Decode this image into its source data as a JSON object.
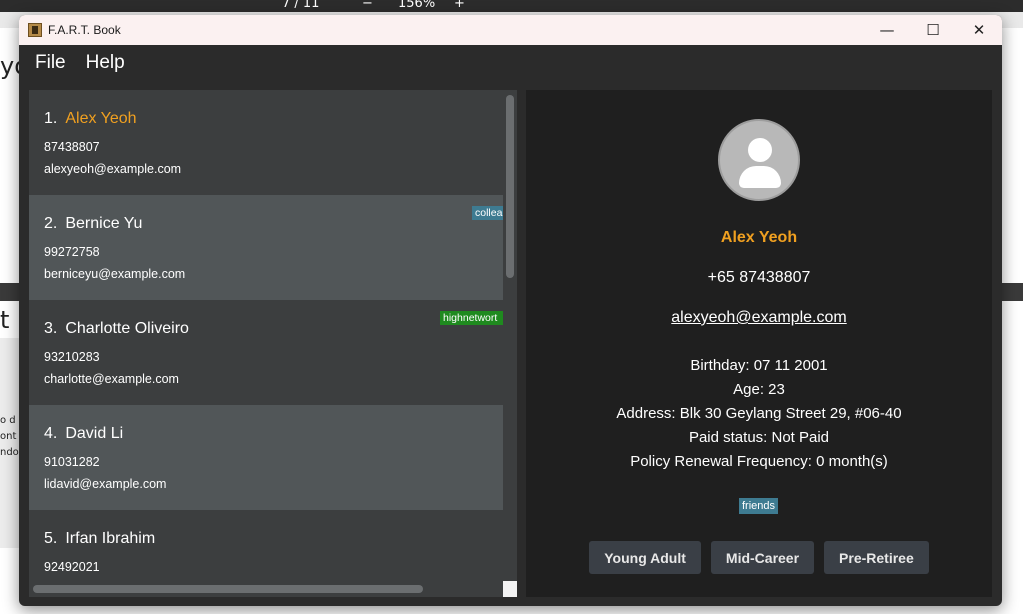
{
  "window": {
    "title": "F.A.R.T. Book",
    "minimize_glyph": "—",
    "maximize_glyph": "☐",
    "close_glyph": "✕"
  },
  "menu": {
    "items": [
      "File",
      "Help"
    ]
  },
  "persons": [
    {
      "index": "1.",
      "name": "Alex Yeoh",
      "phone": "87438807",
      "email": "alexyeoh@example.com",
      "tag": ""
    },
    {
      "index": "2.",
      "name": "Bernice Yu",
      "phone": "99272758",
      "email": "berniceyu@example.com",
      "tag": "collea"
    },
    {
      "index": "3.",
      "name": "Charlotte Oliveiro",
      "phone": "93210283",
      "email": "charlotte@example.com",
      "tag": "highnetwort"
    },
    {
      "index": "4.",
      "name": "David Li",
      "phone": "91031282",
      "email": "lidavid@example.com",
      "tag": ""
    },
    {
      "index": "5.",
      "name": "Irfan Ibrahim",
      "phone": "92492021",
      "email": "",
      "tag": ""
    }
  ],
  "details": {
    "name": "Alex Yeoh",
    "phone": "+65 87438807",
    "email": "alexyeoh@example.com",
    "birthday": "Birthday: 07 11 2001",
    "age": "Age: 23",
    "address": "Address: Blk 30 Geylang Street 29, #06-40",
    "paid_status": "Paid status: Not Paid",
    "renewal": "Policy Renewal Frequency: 0 month(s)",
    "tag": "friends",
    "buttons": [
      "Young Adult",
      "Mid-Career",
      "Pre-Retiree"
    ]
  },
  "background": {
    "page_fraction": "7 / 11",
    "zoom": "156%",
    "frag_yo": "yo",
    "frag_tb": "t b",
    "frag_lines": [
      "o d",
      "ont",
      "ndo"
    ]
  },
  "colors": {
    "selected_name": "#f0a020",
    "tag_blue": "#3e7b91",
    "tag_green": "#1f8a1f",
    "button_bg": "#3a3f46"
  }
}
